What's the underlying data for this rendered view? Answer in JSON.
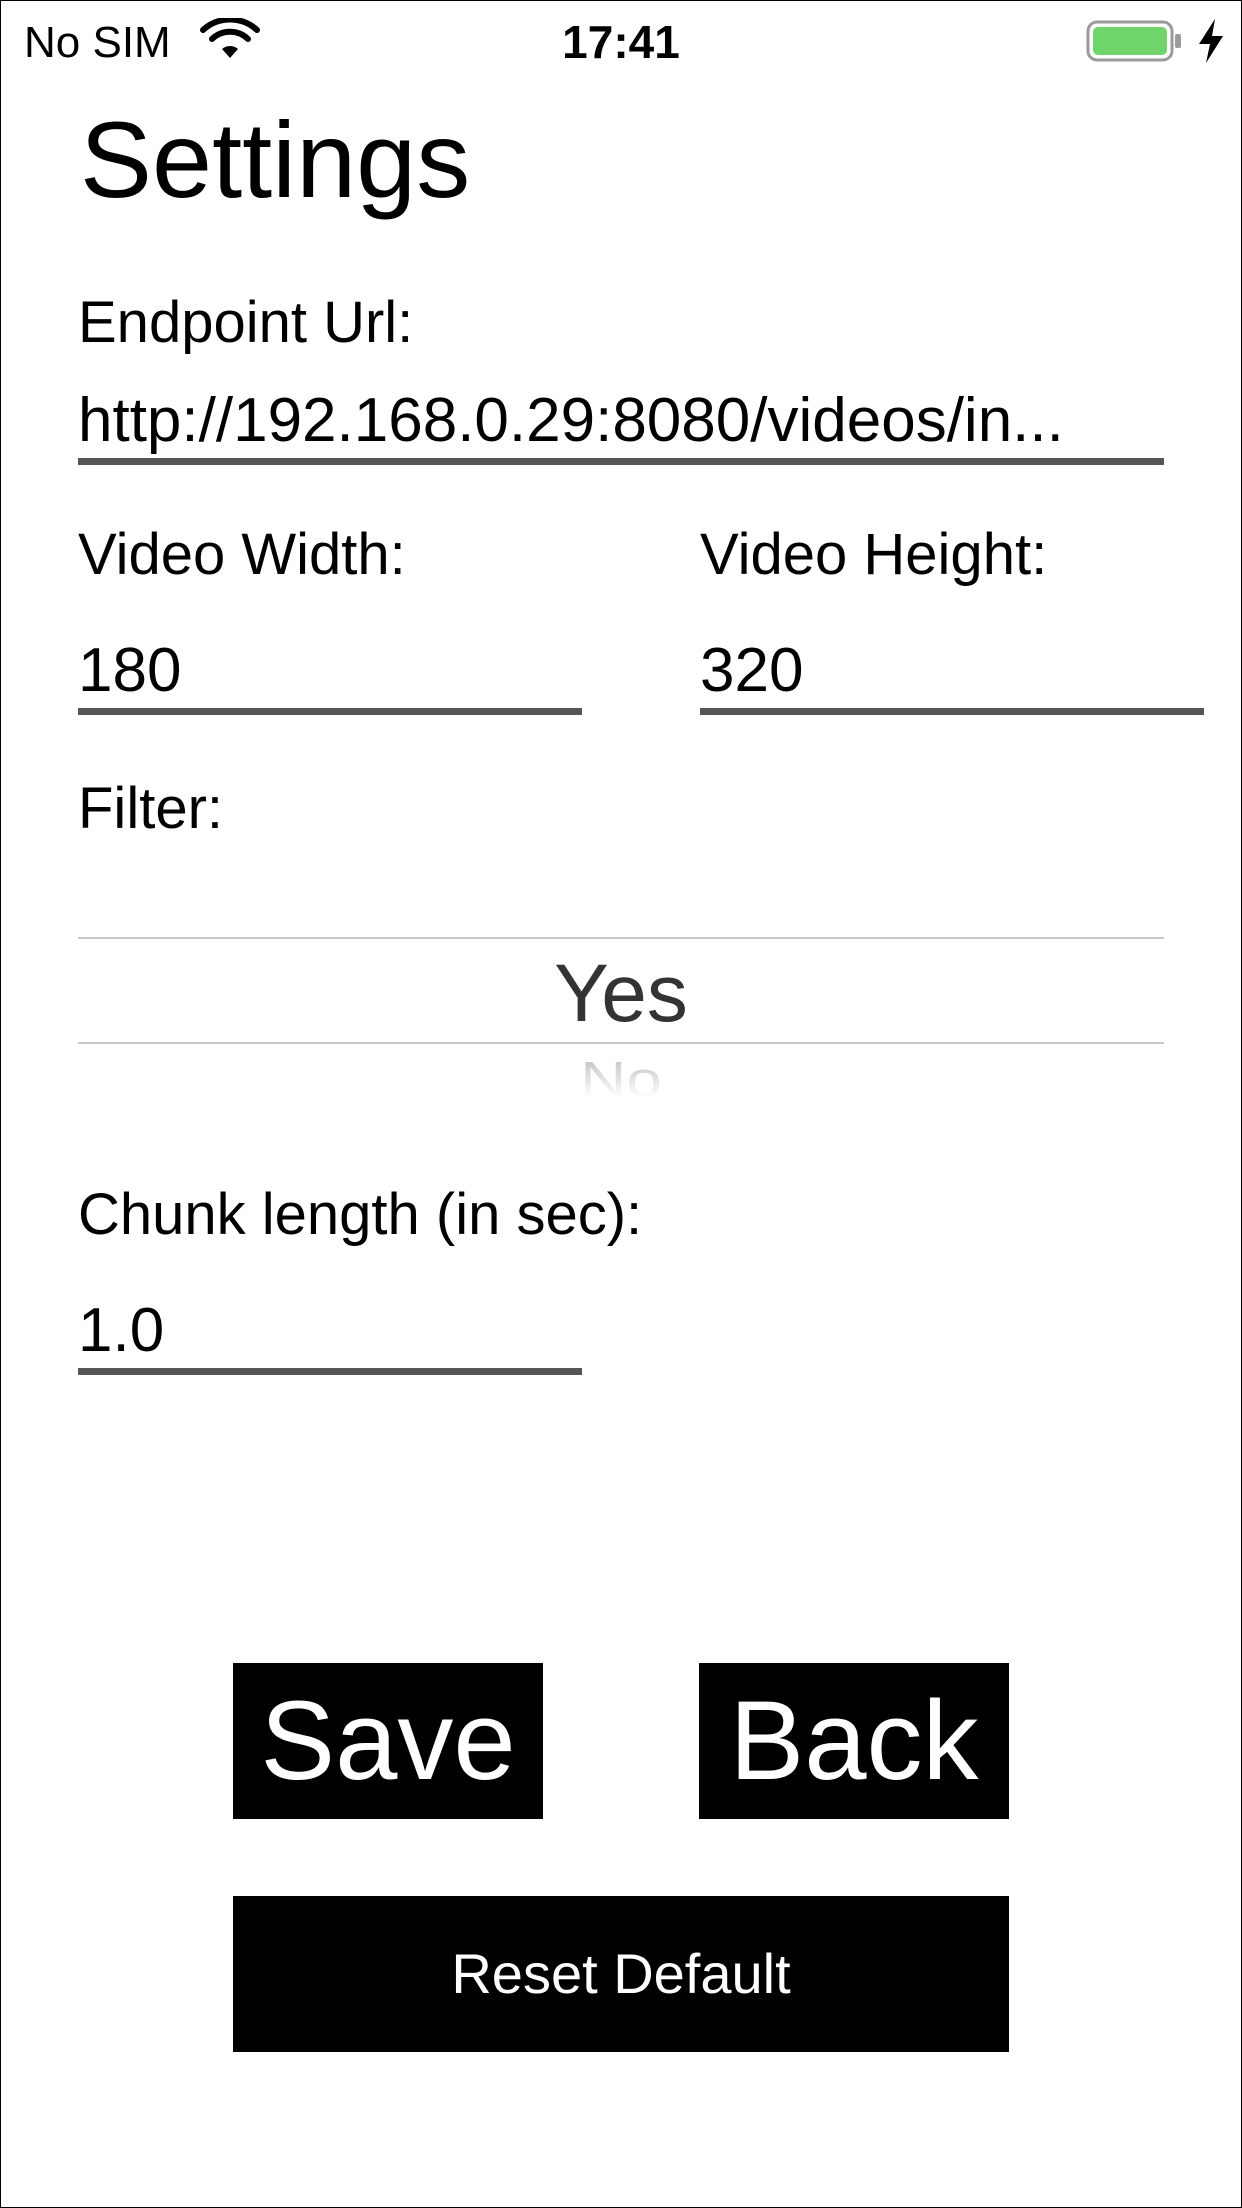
{
  "status_bar": {
    "carrier": "No SIM",
    "time": "17:41",
    "wifi_icon": "wifi-icon",
    "battery_icon": "battery-icon",
    "charging_icon": "charging-bolt-icon",
    "battery_color": "#6fd469",
    "battery_level": 0.95
  },
  "page": {
    "title": "Settings"
  },
  "endpoint": {
    "label": "Endpoint Url:",
    "value": "http://192.168.0.29:8080/videos/in..."
  },
  "video_width": {
    "label": "Video Width:",
    "value": "180"
  },
  "video_height": {
    "label": "Video Height:",
    "value": "320"
  },
  "filter": {
    "label": "Filter:",
    "selected_option": "Yes",
    "next_option": "No"
  },
  "chunk_length": {
    "label": "Chunk length (in sec):",
    "value": "1.0"
  },
  "buttons": {
    "save": "Save",
    "back": "Back",
    "reset": "Reset Default"
  }
}
